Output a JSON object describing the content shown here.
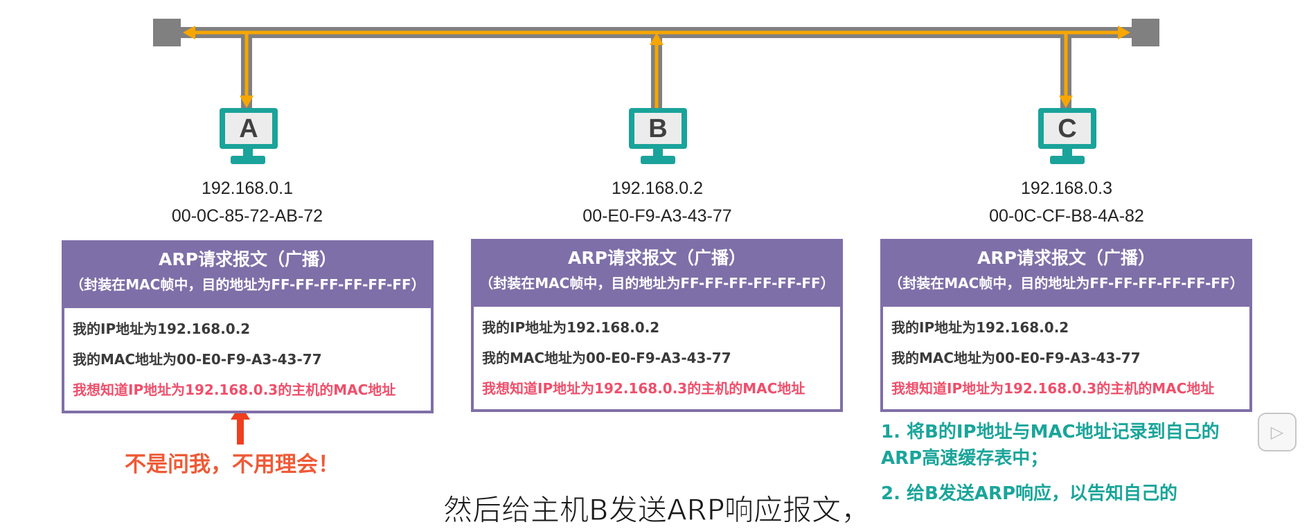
{
  "hosts": [
    {
      "label": "A",
      "ip": "192.168.0.1",
      "mac": "00-0C-85-72-AB-72"
    },
    {
      "label": "B",
      "ip": "192.168.0.2",
      "mac": "00-E0-F9-A3-43-77"
    },
    {
      "label": "C",
      "ip": "192.168.0.3",
      "mac": "00-0C-CF-B8-4A-82"
    }
  ],
  "packet": {
    "title": "ARP请求报文（广播）",
    "subtitle": "（封装在MAC帧中，目的地址为FF-FF-FF-FF-FF-FF）",
    "line_ip": "我的IP地址为192.168.0.2",
    "line_mac": "我的MAC地址为00-E0-F9-A3-43-77",
    "line_ask": "我想知道IP地址为192.168.0.3的主机的MAC地址"
  },
  "note_a": "不是问我，不用理会！",
  "note_c": {
    "step1_line1": "1. 将B的IP地址与MAC地址记录到自己的",
    "step1_line2": "ARP高速缓存表中；",
    "step2": "2. 给B发送ARP响应，以告知自己的"
  },
  "subtitle": "然后给主机B发送ARP响应报文，",
  "colors": {
    "bus": "#808080",
    "signal": "#f7a600",
    "monitor": "#1aa39a",
    "card": "#7f6fa8",
    "ask_text": "#ef4f6b",
    "note_red": "#ef5a36",
    "note_teal": "#1aa59a"
  }
}
